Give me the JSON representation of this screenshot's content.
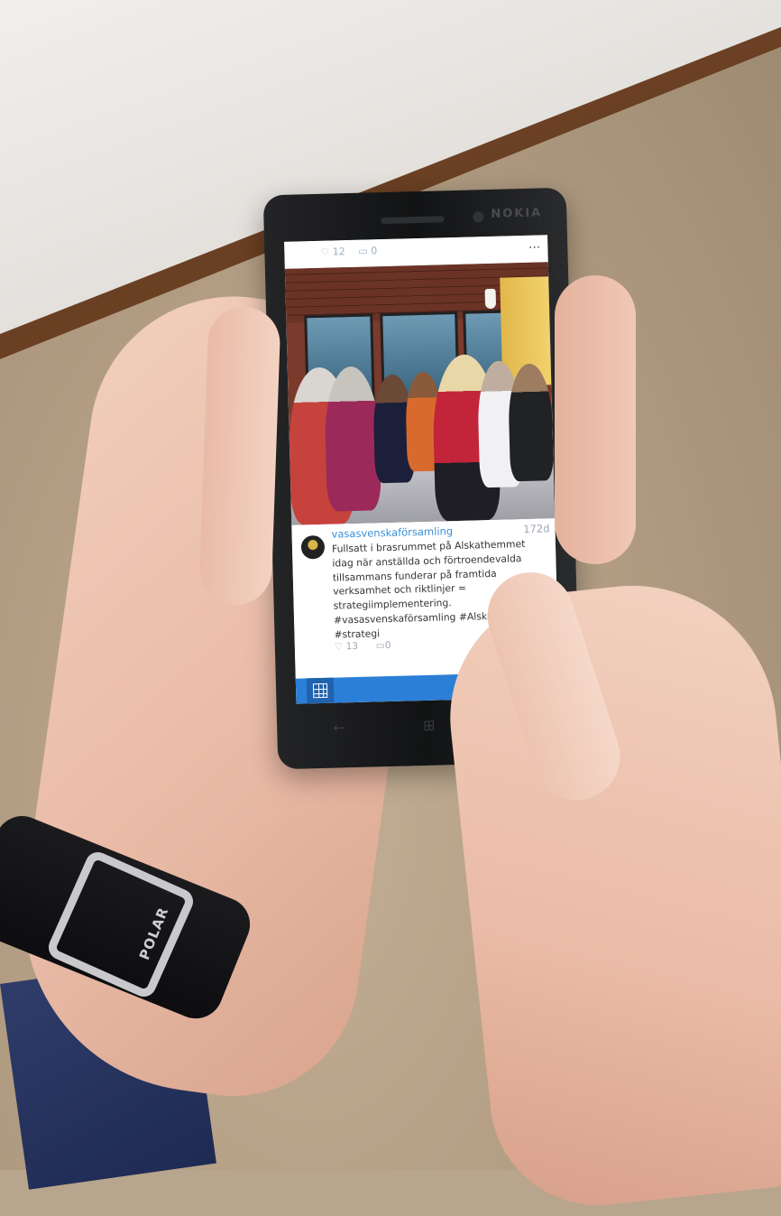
{
  "watch": {
    "brand": "POLAR"
  },
  "phone": {
    "brand": "NOKIA"
  },
  "screen": {
    "previous_post": {
      "likes": "12",
      "comments": "0",
      "more": "..."
    },
    "post": {
      "username": "vasasvenskaförsamling",
      "age": "172d",
      "caption": "Fullsatt i brasrummet på Alskathemmet idag när anställda och förtroendevalda tillsammans funderar på framtida verksamhet och riktlinjer = strategiimplementering. #vasasvenskaförsamling #Alskathemmet #strategi",
      "likes": "13",
      "comments": "0"
    },
    "appbar": {
      "accent": "#2b7fd6",
      "icons": [
        "grid-icon",
        "home-icon",
        "refresh-icon",
        "more-icon"
      ]
    }
  }
}
